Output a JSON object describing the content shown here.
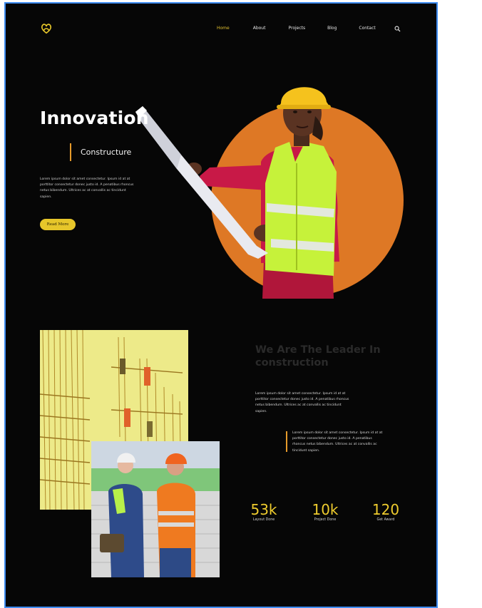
{
  "nav": {
    "items": [
      {
        "label": "Home",
        "active": true
      },
      {
        "label": "About",
        "active": false
      },
      {
        "label": "Projects",
        "active": false
      },
      {
        "label": "Blog",
        "active": false
      },
      {
        "label": "Contact",
        "active": false
      }
    ],
    "search_icon": "search-icon",
    "logo_icon": "knot-logo-icon"
  },
  "hero": {
    "title": "Innovation",
    "subtitle": "Constructure",
    "body": "Lorem ipsum dolor sit amet consectetur. Ipsum id at at porttitor consectetur donec justo id. A penatibus rhoncus netus bibendum. Ultrices ac at convallis ac tincidunt sapien.",
    "cta_label": "Read More"
  },
  "leader": {
    "title": "We Are The Leader In construction",
    "body_1": "Lorem ipsum dolor sit amet consectetur. Ipsum id at at porttitor consectetur donec justo id. A penatibus rhoncus netus bibendum. Ultrices ac at convallis ac tincidunt sapien.",
    "body_2": "Lorem ipsum dolor sit amet consectetur. Ipsum id at at porttitor consectetur donec justo id. A penatibus rhoncus netus bibendum. Ultrices ac at convallis ac tincidunt sapien."
  },
  "stats": [
    {
      "value": "53k",
      "label": "Layout Done"
    },
    {
      "value": "10k",
      "label": "Project Done"
    },
    {
      "value": "120",
      "label": "Get Award"
    }
  ],
  "colors": {
    "background": "#060606",
    "accent_yellow": "#e6c62a",
    "accent_orange": "#de7825",
    "frame_border": "#3d8bf0"
  }
}
